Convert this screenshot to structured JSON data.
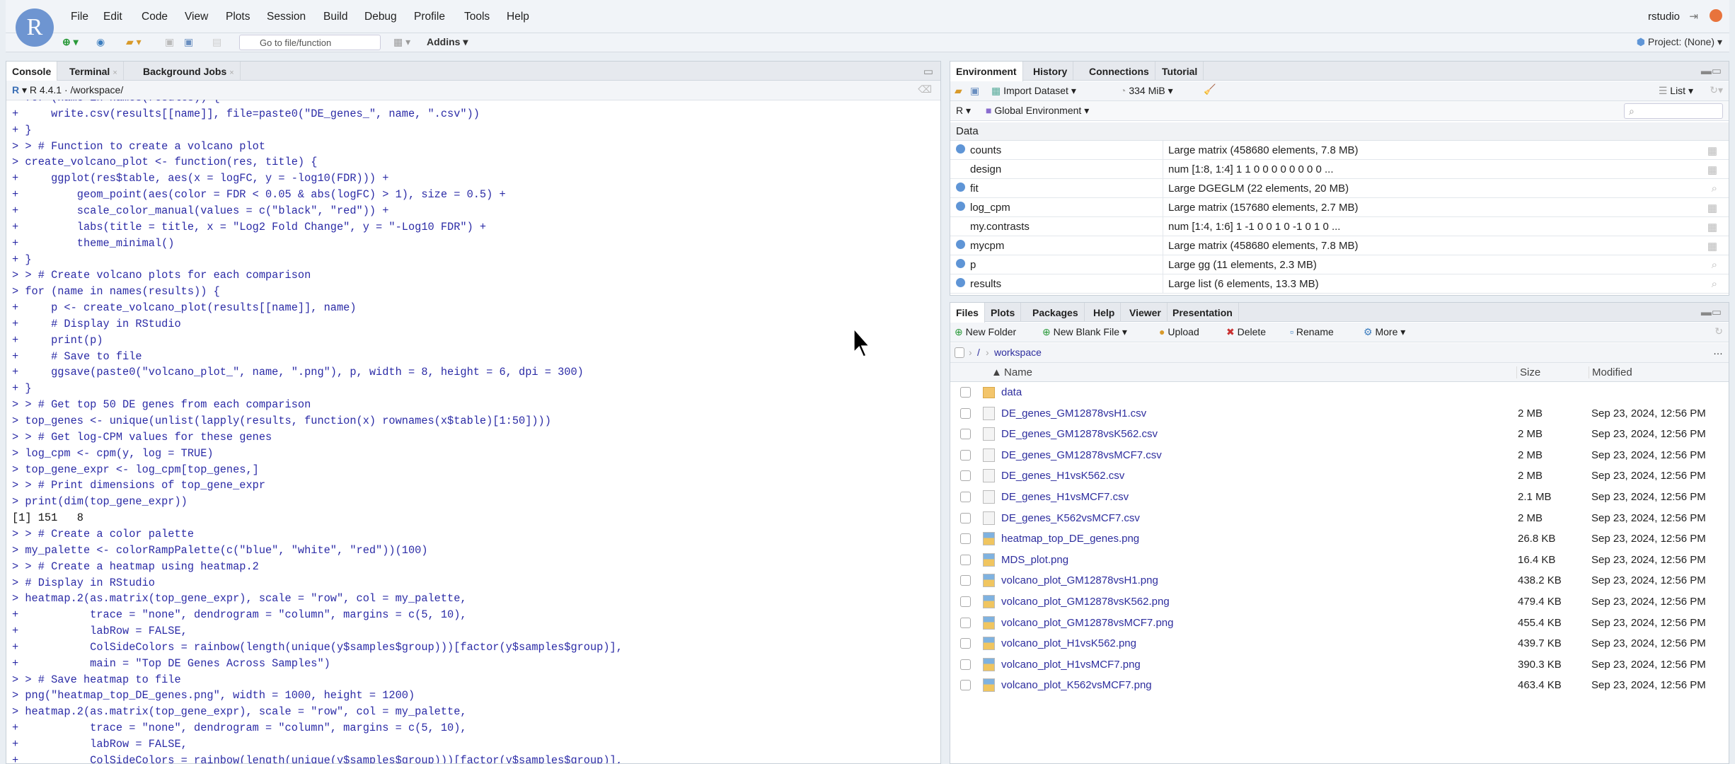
{
  "app": {
    "logo": "R",
    "user": "rstudio",
    "project": "Project: (None)"
  },
  "menu": [
    "File",
    "Edit",
    "Code",
    "View",
    "Plots",
    "Session",
    "Build",
    "Debug",
    "Profile",
    "Tools",
    "Help"
  ],
  "toolbar": {
    "goto_placeholder": "Go to file/function",
    "addins": "Addins"
  },
  "console": {
    "tabs": [
      {
        "label": "Console"
      },
      {
        "label": "Terminal"
      },
      {
        "label": "Background Jobs"
      }
    ],
    "r_version": "R 4.4.1",
    "path": "/workspace/",
    "lines": [
      {
        "t": "> for (name in names(results)) {",
        "o": false
      },
      {
        "t": "+     write.csv(results[[name]], file=paste0(\"DE_genes_\", name, \".csv\"))",
        "o": false
      },
      {
        "t": "+ }",
        "o": false
      },
      {
        "t": "> > # Function to create a volcano plot",
        "o": false
      },
      {
        "t": "> create_volcano_plot <- function(res, title) {",
        "o": false
      },
      {
        "t": "+     ggplot(res$table, aes(x = logFC, y = -log10(FDR))) +",
        "o": false
      },
      {
        "t": "+         geom_point(aes(color = FDR < 0.05 & abs(logFC) > 1), size = 0.5) +",
        "o": false
      },
      {
        "t": "+         scale_color_manual(values = c(\"black\", \"red\")) +",
        "o": false
      },
      {
        "t": "+         labs(title = title, x = \"Log2 Fold Change\", y = \"-Log10 FDR\") +",
        "o": false
      },
      {
        "t": "+         theme_minimal()",
        "o": false
      },
      {
        "t": "+ }",
        "o": false
      },
      {
        "t": "> > # Create volcano plots for each comparison",
        "o": false
      },
      {
        "t": "> for (name in names(results)) {",
        "o": false
      },
      {
        "t": "+     p <- create_volcano_plot(results[[name]], name)",
        "o": false
      },
      {
        "t": "+     # Display in RStudio",
        "o": false
      },
      {
        "t": "+     print(p)",
        "o": false
      },
      {
        "t": "+     # Save to file",
        "o": false
      },
      {
        "t": "+     ggsave(paste0(\"volcano_plot_\", name, \".png\"), p, width = 8, height = 6, dpi = 300)",
        "o": false
      },
      {
        "t": "+ }",
        "o": false
      },
      {
        "t": "> > # Get top 50 DE genes from each comparison",
        "o": false
      },
      {
        "t": "> top_genes <- unique(unlist(lapply(results, function(x) rownames(x$table)[1:50])))",
        "o": false
      },
      {
        "t": "> > # Get log-CPM values for these genes",
        "o": false
      },
      {
        "t": "> log_cpm <- cpm(y, log = TRUE)",
        "o": false
      },
      {
        "t": "> top_gene_expr <- log_cpm[top_genes,]",
        "o": false
      },
      {
        "t": "> > # Print dimensions of top_gene_expr",
        "o": false
      },
      {
        "t": "> print(dim(top_gene_expr))",
        "o": false
      },
      {
        "t": "[1] 151   8",
        "o": true
      },
      {
        "t": "> > # Create a color palette",
        "o": false
      },
      {
        "t": "> my_palette <- colorRampPalette(c(\"blue\", \"white\", \"red\"))(100)",
        "o": false
      },
      {
        "t": "> > # Create a heatmap using heatmap.2",
        "o": false
      },
      {
        "t": "> # Display in RStudio",
        "o": false
      },
      {
        "t": "> heatmap.2(as.matrix(top_gene_expr), scale = \"row\", col = my_palette,",
        "o": false
      },
      {
        "t": "+           trace = \"none\", dendrogram = \"column\", margins = c(5, 10),",
        "o": false
      },
      {
        "t": "+           labRow = FALSE,",
        "o": false
      },
      {
        "t": "+           ColSideColors = rainbow(length(unique(y$samples$group)))[factor(y$samples$group)],",
        "o": false
      },
      {
        "t": "+           main = \"Top DE Genes Across Samples\")",
        "o": false
      },
      {
        "t": "> > # Save heatmap to file",
        "o": false
      },
      {
        "t": "> png(\"heatmap_top_DE_genes.png\", width = 1000, height = 1200)",
        "o": false
      },
      {
        "t": "> heatmap.2(as.matrix(top_gene_expr), scale = \"row\", col = my_palette,",
        "o": false
      },
      {
        "t": "+           trace = \"none\", dendrogram = \"column\", margins = c(5, 10),",
        "o": false
      },
      {
        "t": "+           labRow = FALSE,",
        "o": false
      },
      {
        "t": "+           ColSideColors = rainbow(length(unique(y$samples$group)))[factor(y$samples$group)],",
        "o": false
      }
    ]
  },
  "environment": {
    "tabs": [
      {
        "label": "Environment"
      },
      {
        "label": "History"
      },
      {
        "label": "Connections"
      },
      {
        "label": "Tutorial"
      }
    ],
    "import_dataset": "Import Dataset",
    "memory": "334 MiB",
    "view_mode": "List",
    "language": "R",
    "scope": "Global Environment",
    "section": "Data",
    "rows": [
      {
        "name": "counts",
        "value": "Large matrix (458680 elements,  7.8 MB)",
        "expand": true,
        "action": "grid-icon"
      },
      {
        "name": "design",
        "value": "num [1:8, 1:4] 1 1 0 0 0 0 0 0 0 0 ...",
        "expand": false,
        "action": "grid-icon"
      },
      {
        "name": "fit",
        "value": "Large DGEGLM (22 elements,  20 MB)",
        "expand": true,
        "action": "search-icon"
      },
      {
        "name": "log_cpm",
        "value": "Large matrix (157680 elements,  2.7 MB)",
        "expand": true,
        "action": "grid-icon"
      },
      {
        "name": "my.contrasts",
        "value": "num [1:4, 1:6] 1 -1 0 0 1 0 -1 0 1 0 ...",
        "expand": false,
        "action": "grid-icon"
      },
      {
        "name": "mycpm",
        "value": "Large matrix (458680 elements,  7.8 MB)",
        "expand": true,
        "action": "grid-icon"
      },
      {
        "name": "p",
        "value": "Large gg (11 elements,  2.3 MB)",
        "expand": true,
        "action": "search-icon"
      },
      {
        "name": "results",
        "value": "Large list (6 elements,  13.3 MB)",
        "expand": true,
        "action": "search-icon"
      }
    ]
  },
  "files": {
    "tabs": [
      {
        "label": "Files"
      },
      {
        "label": "Plots"
      },
      {
        "label": "Packages"
      },
      {
        "label": "Help"
      },
      {
        "label": "Viewer"
      },
      {
        "label": "Presentation"
      }
    ],
    "actions": {
      "new_folder": "New Folder",
      "new_blank_file": "New Blank File",
      "upload": "Upload",
      "delete": "Delete",
      "rename": "Rename",
      "more": "More"
    },
    "breadcrumb": {
      "root": "/",
      "current": "workspace"
    },
    "columns": {
      "name": "Name",
      "size": "Size",
      "modified": "Modified"
    },
    "rows": [
      {
        "name": "data",
        "size": "",
        "modified": "",
        "type": "folder"
      },
      {
        "name": "DE_genes_GM12878vsH1.csv",
        "size": "2 MB",
        "modified": "Sep 23, 2024, 12:56 PM",
        "type": "csv"
      },
      {
        "name": "DE_genes_GM12878vsK562.csv",
        "size": "2 MB",
        "modified": "Sep 23, 2024, 12:56 PM",
        "type": "csv"
      },
      {
        "name": "DE_genes_GM12878vsMCF7.csv",
        "size": "2 MB",
        "modified": "Sep 23, 2024, 12:56 PM",
        "type": "csv"
      },
      {
        "name": "DE_genes_H1vsK562.csv",
        "size": "2 MB",
        "modified": "Sep 23, 2024, 12:56 PM",
        "type": "csv"
      },
      {
        "name": "DE_genes_H1vsMCF7.csv",
        "size": "2.1 MB",
        "modified": "Sep 23, 2024, 12:56 PM",
        "type": "csv"
      },
      {
        "name": "DE_genes_K562vsMCF7.csv",
        "size": "2 MB",
        "modified": "Sep 23, 2024, 12:56 PM",
        "type": "csv"
      },
      {
        "name": "heatmap_top_DE_genes.png",
        "size": "26.8 KB",
        "modified": "Sep 23, 2024, 12:56 PM",
        "type": "png"
      },
      {
        "name": "MDS_plot.png",
        "size": "16.4 KB",
        "modified": "Sep 23, 2024, 12:56 PM",
        "type": "png"
      },
      {
        "name": "volcano_plot_GM12878vsH1.png",
        "size": "438.2 KB",
        "modified": "Sep 23, 2024, 12:56 PM",
        "type": "png"
      },
      {
        "name": "volcano_plot_GM12878vsK562.png",
        "size": "479.4 KB",
        "modified": "Sep 23, 2024, 12:56 PM",
        "type": "png"
      },
      {
        "name": "volcano_plot_GM12878vsMCF7.png",
        "size": "455.4 KB",
        "modified": "Sep 23, 2024, 12:56 PM",
        "type": "png"
      },
      {
        "name": "volcano_plot_H1vsK562.png",
        "size": "439.7 KB",
        "modified": "Sep 23, 2024, 12:56 PM",
        "type": "png"
      },
      {
        "name": "volcano_plot_H1vsMCF7.png",
        "size": "390.3 KB",
        "modified": "Sep 23, 2024, 12:56 PM",
        "type": "png"
      },
      {
        "name": "volcano_plot_K562vsMCF7.png",
        "size": "463.4 KB",
        "modified": "Sep 23, 2024, 12:56 PM",
        "type": "png"
      }
    ]
  },
  "colors": {
    "code": "#2b2ba6",
    "file_link": "#2e2e9e",
    "accent": "#5f95d6"
  }
}
